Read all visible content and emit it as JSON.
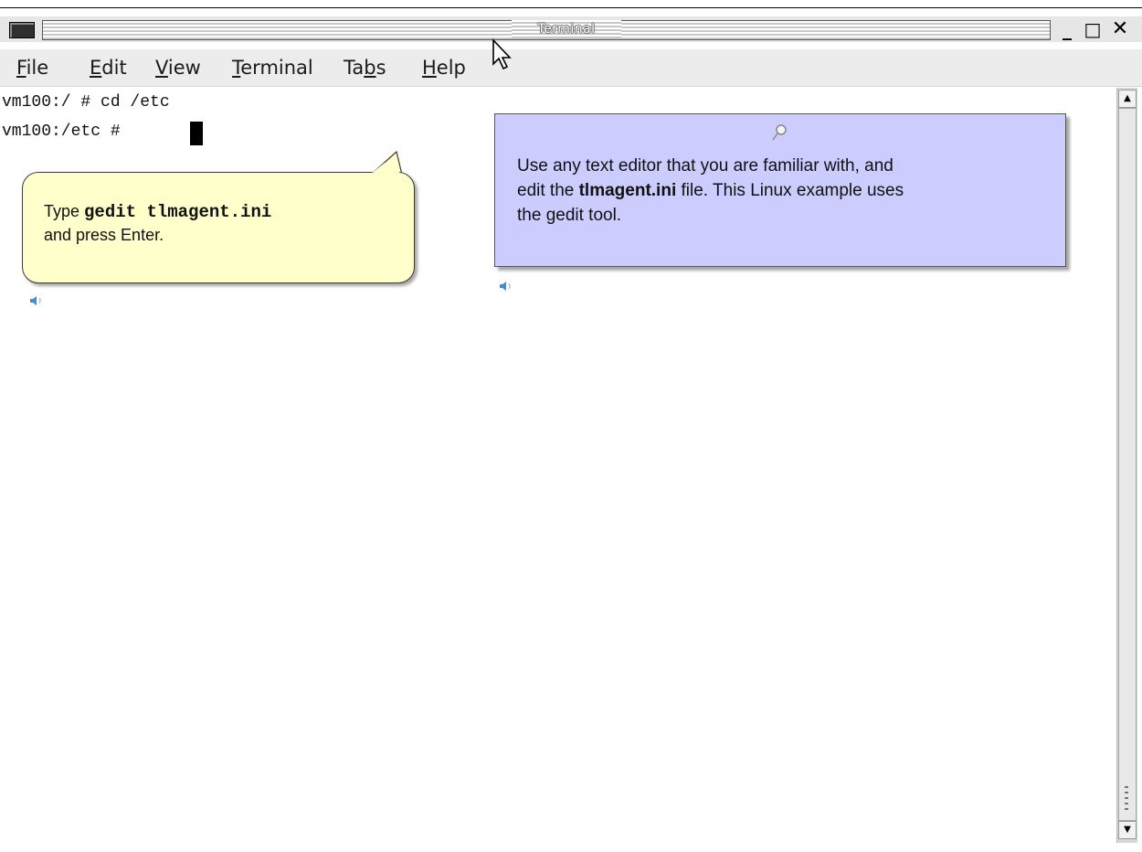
{
  "window": {
    "title": "Terminal",
    "buttons": {
      "minimize": "_",
      "maximize": "□",
      "close": "✕"
    }
  },
  "menu": {
    "items": [
      {
        "label": "File",
        "accel": "F",
        "rest": "ile"
      },
      {
        "label": "Edit",
        "accel": "E",
        "rest": "dit"
      },
      {
        "label": "View",
        "accel": "V",
        "rest": "iew"
      },
      {
        "label": "Terminal",
        "accel": "T",
        "rest": "erminal"
      },
      {
        "label": "Tabs",
        "pre": "Ta",
        "accel": "b",
        "rest": "s"
      },
      {
        "label": "Help",
        "accel": "H",
        "rest": "elp"
      }
    ]
  },
  "terminal": {
    "lines": [
      "vm100:/ # cd /etc",
      "vm100:/etc # "
    ]
  },
  "callout_yellow": {
    "type_word": "Type ",
    "command": "gedit tlmagent.ini",
    "line2": "and press Enter."
  },
  "callout_blue": {
    "line1": "Use any text editor that you are familiar with,  and",
    "line2_pre": "edit the ",
    "filename": "tlmagent.ini",
    "line2_post": "  file. This Linux example uses",
    "line3": "the gedit  tool."
  },
  "colors": {
    "callout_yellow_bg": "#ffffcc",
    "callout_blue_bg": "#ccccff",
    "speaker_icon": "#3a8fd8"
  },
  "icons": {
    "system": "terminal-app-icon",
    "pin": "pin-icon",
    "speaker": "speaker-icon",
    "pointer": "mouse-pointer-icon"
  }
}
